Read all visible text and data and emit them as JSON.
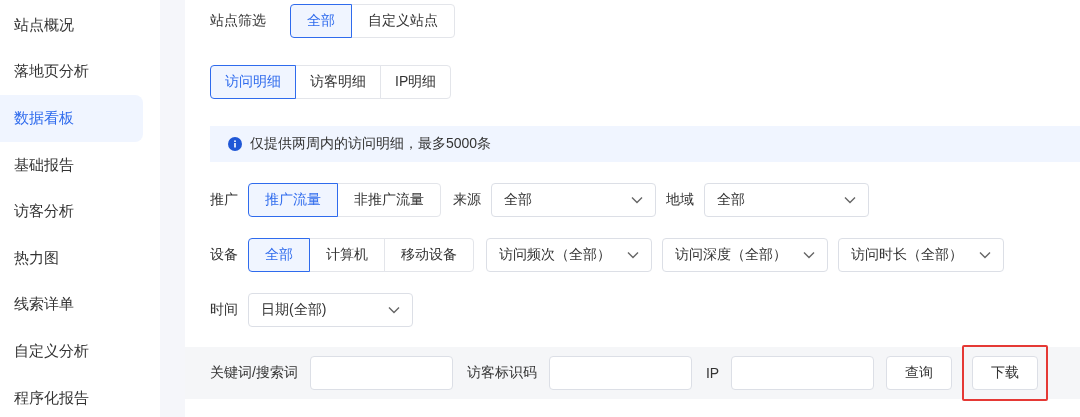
{
  "sidebar": {
    "items": [
      {
        "label": "站点概况",
        "selected": false
      },
      {
        "label": "落地页分析",
        "selected": false
      },
      {
        "label": "数据看板",
        "selected": true
      },
      {
        "label": "基础报告",
        "selected": false
      },
      {
        "label": "访客分析",
        "selected": false
      },
      {
        "label": "热力图",
        "selected": false
      },
      {
        "label": "线索详单",
        "selected": false
      },
      {
        "label": "自定义分析",
        "selected": false
      },
      {
        "label": "程序化报告",
        "selected": false
      }
    ]
  },
  "site_filter": {
    "label": "站点筛选",
    "options": [
      {
        "label": "全部",
        "selected": true
      },
      {
        "label": "自定义站点",
        "selected": false
      }
    ]
  },
  "detail_tabs": [
    {
      "label": "访问明细",
      "selected": true
    },
    {
      "label": "访客明细",
      "selected": false
    },
    {
      "label": "IP明细",
      "selected": false
    }
  ],
  "notice": {
    "text": "仅提供两周内的访问明细，最多5000条"
  },
  "filter_rows": [
    {
      "items": [
        {
          "kind": "label",
          "text": "推广"
        },
        {
          "kind": "segmented",
          "options": [
            {
              "label": "推广流量",
              "selected": true
            },
            {
              "label": "非推广流量",
              "selected": false
            }
          ]
        },
        {
          "kind": "label",
          "text": "来源"
        },
        {
          "kind": "select",
          "value": "全部"
        },
        {
          "kind": "label",
          "text": "地域"
        },
        {
          "kind": "select",
          "value": "全部"
        }
      ]
    },
    {
      "items": [
        {
          "kind": "label",
          "text": "设备"
        },
        {
          "kind": "segmented",
          "options": [
            {
              "label": "全部",
              "selected": true
            },
            {
              "label": "计算机",
              "selected": false
            },
            {
              "label": "移动设备",
              "selected": false
            }
          ]
        },
        {
          "kind": "compact",
          "value": "访问频次（全部）"
        },
        {
          "kind": "compact",
          "value": "访问深度（全部）"
        },
        {
          "kind": "compact",
          "value": "访问时长（全部）"
        }
      ]
    },
    {
      "items": [
        {
          "kind": "label",
          "text": "时间"
        },
        {
          "kind": "select",
          "value": "日期(全部)"
        }
      ]
    }
  ],
  "search_bar": {
    "fields": [
      {
        "label": "关键词/搜索词"
      },
      {
        "label": "访客标识码"
      },
      {
        "label": "IP"
      }
    ],
    "buttons": [
      {
        "label": "查询",
        "highlighted": false
      },
      {
        "label": "下载",
        "highlighted": true
      }
    ]
  }
}
